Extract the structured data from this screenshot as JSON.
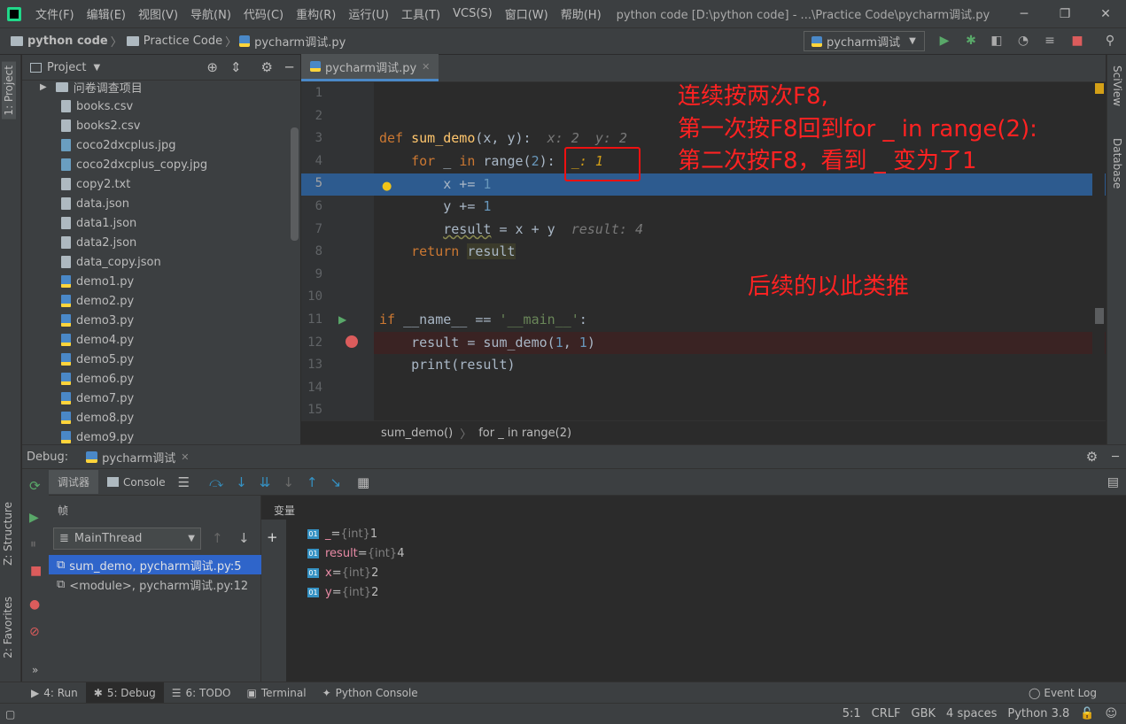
{
  "menubar": {
    "items": [
      "文件(F)",
      "编辑(E)",
      "视图(V)",
      "导航(N)",
      "代码(C)",
      "重构(R)",
      "运行(U)",
      "工具(T)",
      "VCS(S)",
      "窗口(W)",
      "帮助(H)"
    ],
    "title": "python code [D:\\python code] - ...\\Practice Code\\pycharm调试.py"
  },
  "nav": {
    "crumbs": [
      "python code",
      "Practice Code",
      "pycharm调试.py"
    ],
    "run_config": "pycharm调试"
  },
  "left_strip": {
    "project": "1: Project",
    "structure": "Z: Structure",
    "favorites": "2: Favorites"
  },
  "right_strip": {
    "sciview": "SciView",
    "database": "Database"
  },
  "project": {
    "title": "Project",
    "folder": "问卷调查项目",
    "files": [
      "books.csv",
      "books2.csv",
      "coco2dxcplus.jpg",
      "coco2dxcplus_copy.jpg",
      "copy2.txt",
      "data.json",
      "data1.json",
      "data2.json",
      "data_copy.json",
      "demo1.py",
      "demo2.py",
      "demo3.py",
      "demo4.py",
      "demo5.py",
      "demo6.py",
      "demo7.py",
      "demo8.py",
      "demo9.py"
    ]
  },
  "editor": {
    "tab": "pycharm调试.py",
    "line_numbers": [
      "1",
      "2",
      "3",
      "4",
      "5",
      "6",
      "7",
      "8",
      "9",
      "10",
      "11",
      "12",
      "13",
      "14",
      "15"
    ],
    "breadcrumbs": [
      "sum_demo()",
      "for _ in range(2)"
    ],
    "hint_line3": "x: 2  y: 2",
    "hint_line4": "_: 1",
    "hint_line7": "result: 4"
  },
  "annotations": {
    "line1": "连续按两次F8,",
    "line2": "第一次按F8回到for _ in range(2):",
    "line3": "第二次按F8，看到 _ 变为了1",
    "line4": "后续的以此类推"
  },
  "debug": {
    "label": "Debug:",
    "session": "pycharm调试",
    "tab_debugger": "调试器",
    "tab_console": "Console",
    "frames_label": "帧",
    "thread": "MainThread",
    "frames": [
      "sum_demo, pycharm调试.py:5",
      "<module>, pycharm调试.py:12"
    ],
    "vars_label": "变量",
    "variables": [
      {
        "name": "_",
        "type": "{int}",
        "value": "1"
      },
      {
        "name": "result",
        "type": "{int}",
        "value": "4"
      },
      {
        "name": "x",
        "type": "{int}",
        "value": "2"
      },
      {
        "name": "y",
        "type": "{int}",
        "value": "2"
      }
    ]
  },
  "bottom_tabs": [
    "4: Run",
    "5: Debug",
    "6: TODO",
    "Terminal",
    "Python Console"
  ],
  "event_log": "Event Log",
  "status": {
    "position": "5:1",
    "line_sep": "CRLF",
    "encoding": "GBK",
    "indent": "4 spaces",
    "interpreter": "Python 3.8"
  }
}
